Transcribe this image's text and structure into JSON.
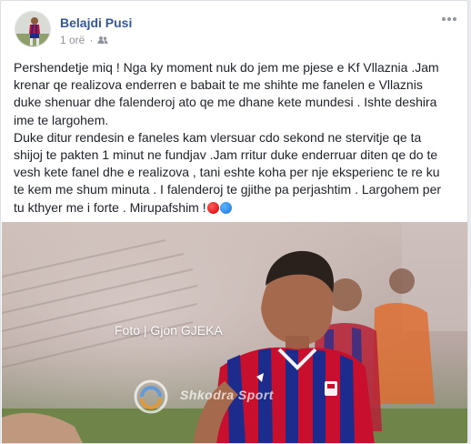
{
  "post": {
    "author": "Belajdi Pusi",
    "time": "1 orë",
    "separator": "·",
    "audience_icon": "friends-icon",
    "more_icon": "more-options-icon",
    "text_lines": [
      "Pershendetje miq ! Nga ky moment nuk do jem me pjese e Kf Vllaznia .Jam",
      "krenar qe realizova enderren e babait te me shihte me fanelen e Vllaznis",
      "duke shenuar dhe falenderoj ato qe me dhane kete mundesi . Ishte deshira",
      "ime te largohem.",
      "Duke ditur rendesin e faneles kam vlersuar cdo sekond ne stervitje qe ta",
      "shijoj te pakten 1 minut ne fundjav .Jam rritur duke enderruar diten qe do te",
      "vesh kete fanel dhe e realizova , tani eshte koha per nje eksperienc te re ku",
      "te kem me shum minuta . I falenderoj te gjithe pa perjashtim . Largohem per",
      "tu kthyer me i forte . Mirupafshim !"
    ],
    "emojis": [
      "red-circle-emoji",
      "blue-circle-emoji"
    ]
  },
  "photo": {
    "credit": "Foto | Gjon GJEKA",
    "watermark": "Shkodra Sport",
    "watermark_icon": "shkodra-sport-logo-icon"
  },
  "colors": {
    "author_link": "#365899",
    "meta_text": "#90949c",
    "body_text": "#1d2129",
    "jersey_red": "#c8102e",
    "jersey_blue": "#1d2b8c"
  }
}
